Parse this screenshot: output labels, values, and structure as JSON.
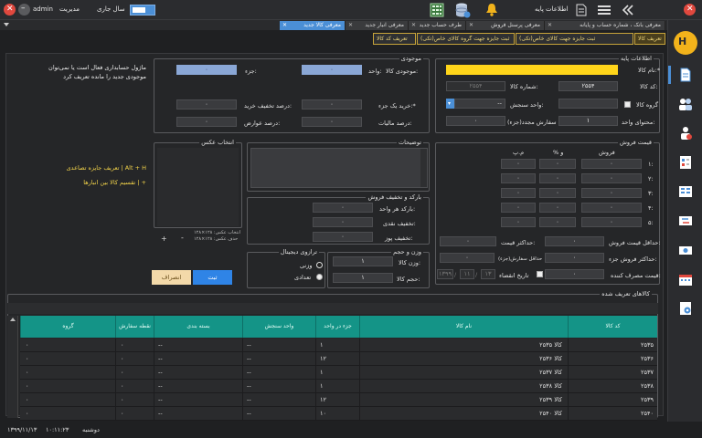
{
  "topbar": {
    "user": "admin",
    "role": "مدیریت",
    "year_label": "سال جاری",
    "app_title": "اطلاعات پایه"
  },
  "tabs": [
    {
      "label": "معرفی بانک ، شماره حساب و پایانه"
    },
    {
      "label": "معرفی پرسنل فروش"
    },
    {
      "label": "طرف حساب جدید"
    },
    {
      "label": "معرفی انبار جدید"
    },
    {
      "label": "معرفی کالا جدید"
    }
  ],
  "subtabs": [
    {
      "label": "تعریف کالا"
    },
    {
      "label": "ثبت جایزه جهت کالای خاص(تکی)"
    },
    {
      "label": "ثبت جایزه جهت گروه کالای خاص(تکی)"
    },
    {
      "label": "تعریف کد کالا"
    }
  ],
  "base_info": {
    "title": "اطلاعات پایه",
    "name_label": "نام کالا:*",
    "name_value": "",
    "code_label": "کد کالا:",
    "code_value": "۲۵۵۴",
    "number_label": "شماره کالا:",
    "number_value": "۲۵۵۴",
    "group_label": "گروه کالا",
    "unit_label": "واحد سنجش:",
    "unit_value": "--",
    "content_label": "محتوای واحد:",
    "content_value": "۱",
    "reorder_label": "سفارش مجدد(جزء)",
    "reorder_value": "۰"
  },
  "stock": {
    "title": "موجودی",
    "stock_label": "موجودی کالا:",
    "unit_label": "واحد:",
    "part_label": "جزء:",
    "unit_value": "۰",
    "part_value": "۰",
    "buy_label": "خرید یک جزء:*",
    "buy_value": "۰",
    "discount_label": "درصد تخفیف خرید:",
    "discount_value": "۰",
    "tax_label": "درصد مالیات:",
    "tax_value": "۰",
    "duty_label": "درصد عوارض:",
    "duty_value": "۰"
  },
  "notice": {
    "line1": "ماژول حسابداری فعال است یا نمی‌توان",
    "line2": "موجودی جدید را مانده تعریف کرد",
    "shortcut1": "تعریف جایزه تصاعدی | Alt + H",
    "shortcut2": "تقسیم کالا بین انبارها | +"
  },
  "price": {
    "title": "قیمت فروش",
    "col_sale": "فروش",
    "col_percent": "% و",
    "col_cons": "م.پ",
    "rows": [
      {
        "label": "۱:",
        "sale": "۰",
        "percent": "۰",
        "cons": "۰"
      },
      {
        "label": "۲:",
        "sale": "۰",
        "percent": "۰",
        "cons": "۰"
      },
      {
        "label": "۳:",
        "sale": "۰",
        "percent": "۰",
        "cons": "۰"
      },
      {
        "label": "۴:",
        "sale": "۰",
        "percent": "۰",
        "cons": "۰"
      },
      {
        "label": "۵:",
        "sale": "۰",
        "percent": "۰",
        "cons": "۰"
      }
    ],
    "min_label": "حداقل قیمت فروش:",
    "min_value": "۰",
    "max_label": "حداکثر قیمت:",
    "max_value": "۰",
    "max_sale_label": "حداکثر فروش جزء:",
    "max_sale_value": "۰",
    "max_sale_sub": "حداقل سفارش(جزء)",
    "max_sale_sub_value": "۰",
    "consumer_label": "قیمت مصرف کننده:",
    "consumer_value": "۰",
    "expiry_label": "تاریخ انقضاء",
    "expiry_day": "۱۳",
    "expiry_month": "۱۱",
    "expiry_year": "۱۳۹۹"
  },
  "desc": {
    "title": "توضیحات"
  },
  "image": {
    "title": "انتخاب عکس",
    "size1": "انتخاب عکس: ۱۲۸×۱۲۸",
    "size2": "حذف عکس: ۱۲۸×۱۲۸",
    "plus": "+",
    "minus": "-"
  },
  "barcode": {
    "title": "بارکد و تخفیف فروش",
    "barcode_label": "بارکد هر واحد:",
    "barcode_value": "۰",
    "cash_label": "تخفیف نقدی:",
    "cash_value": "۰",
    "check_label": "تخفیف پوز:",
    "check_value": "۰"
  },
  "scale": {
    "title": "ترازوی دیجیتال",
    "weight": "وزنی",
    "count": "تعدادی"
  },
  "weight": {
    "title": "وزن و حجم",
    "weight_label": "وزن کالا:",
    "weight_value": "۱",
    "volume_label": "حجم کالا:",
    "volume_value": "۱"
  },
  "buttons": {
    "save": "ثبت",
    "cancel": "انصراف"
  },
  "table": {
    "title": "کالاهای تعریف شده",
    "columns": [
      "کد کالا",
      "نام کالا",
      "جزء در واحد",
      "واحد سنجش",
      "بسته بندی",
      "نقطه سفارش",
      "گروه"
    ],
    "rows": [
      {
        "code": "۲۵۳۵",
        "name": "کالا ۲۵۳۵",
        "part": "۱",
        "unit": "--",
        "pack": "--",
        "order": "۰",
        "group": "۰"
      },
      {
        "code": "۲۵۳۶",
        "name": "کالا ۲۵۳۶",
        "part": "۱۲",
        "unit": "--",
        "pack": "--",
        "order": "۰",
        "group": "۰"
      },
      {
        "code": "۲۵۳۷",
        "name": "کالا ۲۵۳۷",
        "part": "۱",
        "unit": "--",
        "pack": "--",
        "order": "۰",
        "group": "۰"
      },
      {
        "code": "۲۵۳۸",
        "name": "کالا ۲۵۳۸",
        "part": "۱",
        "unit": "--",
        "pack": "--",
        "order": "۰",
        "group": "۰"
      },
      {
        "code": "۲۵۳۹",
        "name": "کالا ۲۵۳۹",
        "part": "۱۲",
        "unit": "--",
        "pack": "--",
        "order": "۰",
        "group": "۰"
      },
      {
        "code": "۲۵۴۰",
        "name": "کالا ۲۵۴۰",
        "part": "۱۰",
        "unit": "--",
        "pack": "--",
        "order": "۰",
        "group": "۰"
      }
    ]
  },
  "status": {
    "day": "دوشنبه",
    "time": "۱۰:۱۱:۲۳",
    "date": "۱۳۹۹/۱۱/۱۳"
  },
  "colors": {
    "accent": "#4b8fd6",
    "highlight": "#ffd51a",
    "table_head": "#149487",
    "close": "#e0483e"
  },
  "icons": [
    "close-icon",
    "minimize-icon",
    "menu-icon",
    "document-icon",
    "bell-icon",
    "database-icon",
    "calculator-icon",
    "double-chevron-icon"
  ]
}
